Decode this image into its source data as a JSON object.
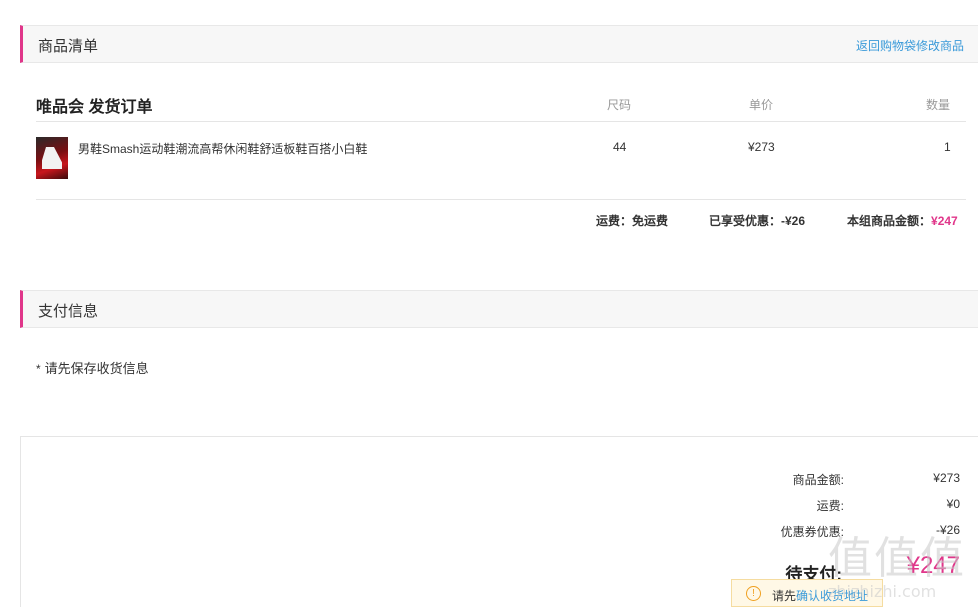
{
  "goods_section": {
    "title": "商品清单",
    "back_link": "返回购物袋修改商品"
  },
  "order": {
    "title": "唯品会 发货订单",
    "columns": {
      "size": "尺码",
      "price": "单价",
      "qty": "数量"
    },
    "items": [
      {
        "name": "男鞋Smash运动鞋潮流高帮休闲鞋舒适板鞋百搭小白鞋",
        "size": "44",
        "price": "¥273",
        "qty": "1"
      }
    ],
    "summary": {
      "shipping_label": "运费：",
      "shipping_value": "免运费",
      "discount_label": "已享受优惠：",
      "discount_value": "-¥26",
      "group_total_label": "本组商品金额：",
      "group_total_value": "¥247"
    }
  },
  "payment_section": {
    "title": "支付信息",
    "note_star": "*",
    "note": "请先保存收货信息"
  },
  "totals": {
    "goods_amount_label": "商品金额:",
    "goods_amount_value": "¥273",
    "shipping_label": "运费:",
    "shipping_value": "¥0",
    "coupon_label": "优惠券优惠:",
    "coupon_value": "-¥26",
    "due_label": "待支付:",
    "due_value": "¥247"
  },
  "warning": {
    "prefix": "请先",
    "link": "确认收货地址"
  },
  "watermark": {
    "logo": "值值值",
    "text": "zhizhizhi.com"
  },
  "colors": {
    "accent": "#e0368a",
    "link": "#3a9ad9"
  }
}
